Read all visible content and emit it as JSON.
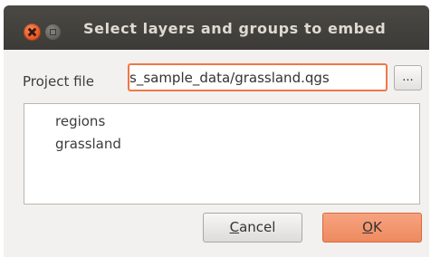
{
  "window": {
    "title": "Select layers and groups to embed"
  },
  "form": {
    "project_file_label": "Project file",
    "project_file_value": "s_sample_data/grassland.qgs",
    "browse_label": "..."
  },
  "tree": {
    "items": [
      {
        "label": "regions"
      },
      {
        "label": "grassland"
      }
    ]
  },
  "buttons": {
    "cancel_label": "Cancel",
    "ok_label": "OK"
  },
  "colors": {
    "titlebar": "#3c3b37",
    "accent": "#f07746",
    "ok_button": "#ee8a5f"
  },
  "icons": {
    "close": "close-icon",
    "maximize": "maximize-icon"
  }
}
